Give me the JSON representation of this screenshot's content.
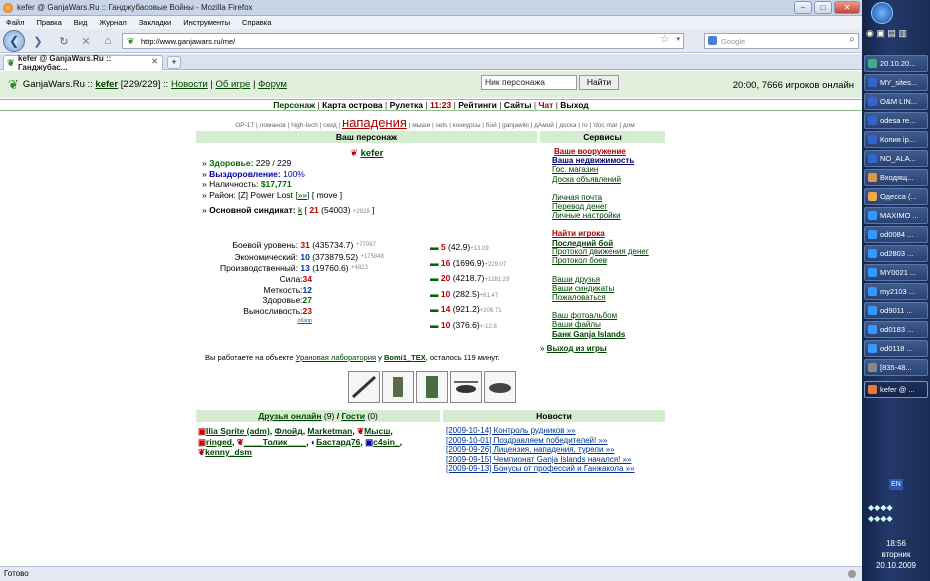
{
  "window": {
    "title": "kefer @ GanjaWars.Ru :: Ганджубасовые Войны - Mozilla Firefox"
  },
  "menubar": [
    "Файл",
    "Правка",
    "Вид",
    "Журнал",
    "Закладки",
    "Инструменты",
    "Справка"
  ],
  "navbar": {
    "url": "http://www.ganjawars.ru/me/",
    "search_placeholder": "Google"
  },
  "tab": {
    "label": "kefer @ GanjaWars.Ru :: Ганджубас..."
  },
  "status": "Готово",
  "header": {
    "site": "GanjaWars.Ru",
    "sep1": "::",
    "user": "kefer",
    "level": "[229/229]",
    "sep2": "::",
    "news": "Новости",
    "sep3": "|",
    "about": "Об игре",
    "sep4": "|",
    "forum": "Форум",
    "nick_placeholder": "Ник персонажа",
    "find": "Найти",
    "online": "20:00, 7666 игроков онлайн"
  },
  "topmenu": [
    "Персонаж",
    "Карта острова",
    "Рулетка",
    "11:23",
    "Рейтинги",
    "Сайты",
    "Чат",
    "Выход"
  ],
  "submenu": {
    "left": "OP-1T | ломанов | high-tech | скид |",
    "big": "нападения",
    "right": "| мыши | sets | конкурсы | бой | ganjawiki | дАмой | доска | ro | 'doc mar | дом"
  },
  "char": {
    "title": "Ваш персонаж",
    "name": "kefer",
    "health_label": "Здоровье:",
    "health": "229 / 229",
    "recovery_label": "Выздоровление:",
    "recovery": "100%",
    "cash_label": "Наличность:",
    "cash": "$17,771",
    "district_label": "Район:",
    "district": "[Z] Power Lost",
    "district_link": "[»»]",
    "move": "[ move ]",
    "syndicate_label": "Основной синдикат:",
    "syndicate_link": "k",
    "syndicate_num": "21",
    "syndicate_pts": "(54003)",
    "syndicate_plus": "+2928",
    "levels": [
      {
        "label": "Боевой уровень:",
        "lvl": "31",
        "pts": "(435734.7)",
        "plus": "+77087"
      },
      {
        "label": "Экономический:",
        "lvl": "10",
        "pts": "(373879.52)",
        "plus": "+175848"
      },
      {
        "label": "Производственный:",
        "lvl": "13",
        "pts": "(19760.6)",
        "plus": "+4823"
      }
    ],
    "stats": [
      {
        "label": "Сила:",
        "val": "34"
      },
      {
        "label": "Меткость:",
        "val": "12"
      },
      {
        "label": "Здоровье:",
        "val": "27"
      },
      {
        "label": "Выносливость:",
        "val": "23"
      }
    ],
    "bonus": "обзор",
    "weapons": [
      {
        "lvl": "5",
        "pts": "(42.9)",
        "plus": "+13.09"
      },
      {
        "lvl": "16",
        "pts": "(1696.9)",
        "plus": "+229.07"
      },
      {
        "lvl": "20",
        "pts": "(4218.7)",
        "plus": "+1281.29"
      },
      {
        "lvl": "10",
        "pts": "(282.5)",
        "plus": "+61.47"
      },
      {
        "lvl": "14",
        "pts": "(921.2)",
        "plus": "+206.71"
      },
      {
        "lvl": "10",
        "pts": "(376.6)",
        "plus": "+-12.6"
      }
    ],
    "work_pre": "Вы работаете на объекте",
    "work_obj": "Урановая лаборатория",
    "work_mid": "у",
    "work_owner": "Bomi1_TEX",
    "work_post": ", осталось 119 минут."
  },
  "services": {
    "title": "Сервисы",
    "groups": [
      [
        "Ваше вооружение",
        "Ваша недвижимость",
        "Гос. магазин",
        "Доска объявлений"
      ],
      [
        "Личная почта",
        "Перевод денег",
        "Личные настройки"
      ],
      [
        "Найти игрока",
        "Последний бой",
        "Протокол движения денег",
        "Протокол боев"
      ],
      [
        "Ваши друзья",
        "Ваши синдикаты",
        "Пожаловаться"
      ],
      [
        "Ваш фотоальбом",
        "Ваши файлы",
        "Банк Ganja Islands"
      ]
    ],
    "exit": "Выход из игры"
  },
  "friends": {
    "title_friends": "Друзья онлайн",
    "count_friends": "(9)",
    "sep": "/",
    "title_guests": "Гости",
    "count_guests": "(0)",
    "list": [
      "Ilia Sprite (adm)",
      "Флойд",
      "Marketman",
      "Мысш",
      "ringed",
      "____Толик____",
      "Бастард76",
      "c4sin_",
      "kenny_dsm"
    ]
  },
  "news": {
    "title": "Новости",
    "items": [
      "[2009-10-14] Контроль рудников »»",
      "[2009-10-01] Поздравляем победителей! »»",
      "[2009-09-26] Лицензия, нападения, турели »»",
      "[2009-09-15] Чемпионат Ganja Islands начался! »»",
      "[2009-09-13] Бонусы от профессий и Ганжакола »»"
    ]
  },
  "taskbar": {
    "items": [
      "20.10.20...",
      "MY_sites...",
      "O&M LIN...",
      "odesa re...",
      "Копия ip...",
      "NO_ALA...",
      "Входящ...",
      "Одесса (...",
      "MAXIMO ...",
      "od0084 ...",
      "od2803 ...",
      "MY0021 ...",
      "my2103 ...",
      "od9011 ...",
      "od0183 ...",
      "od0118 ...",
      "[835-48...",
      "kefer @ ..."
    ],
    "lang": "EN",
    "time": "18:56",
    "day": "вторник",
    "date": "20.10.2009"
  },
  "colors": {
    "header_bg": "#e0f0dc",
    "panel_header": "#d4ecd0",
    "link": "#004400",
    "accent_red": "#b00000"
  }
}
